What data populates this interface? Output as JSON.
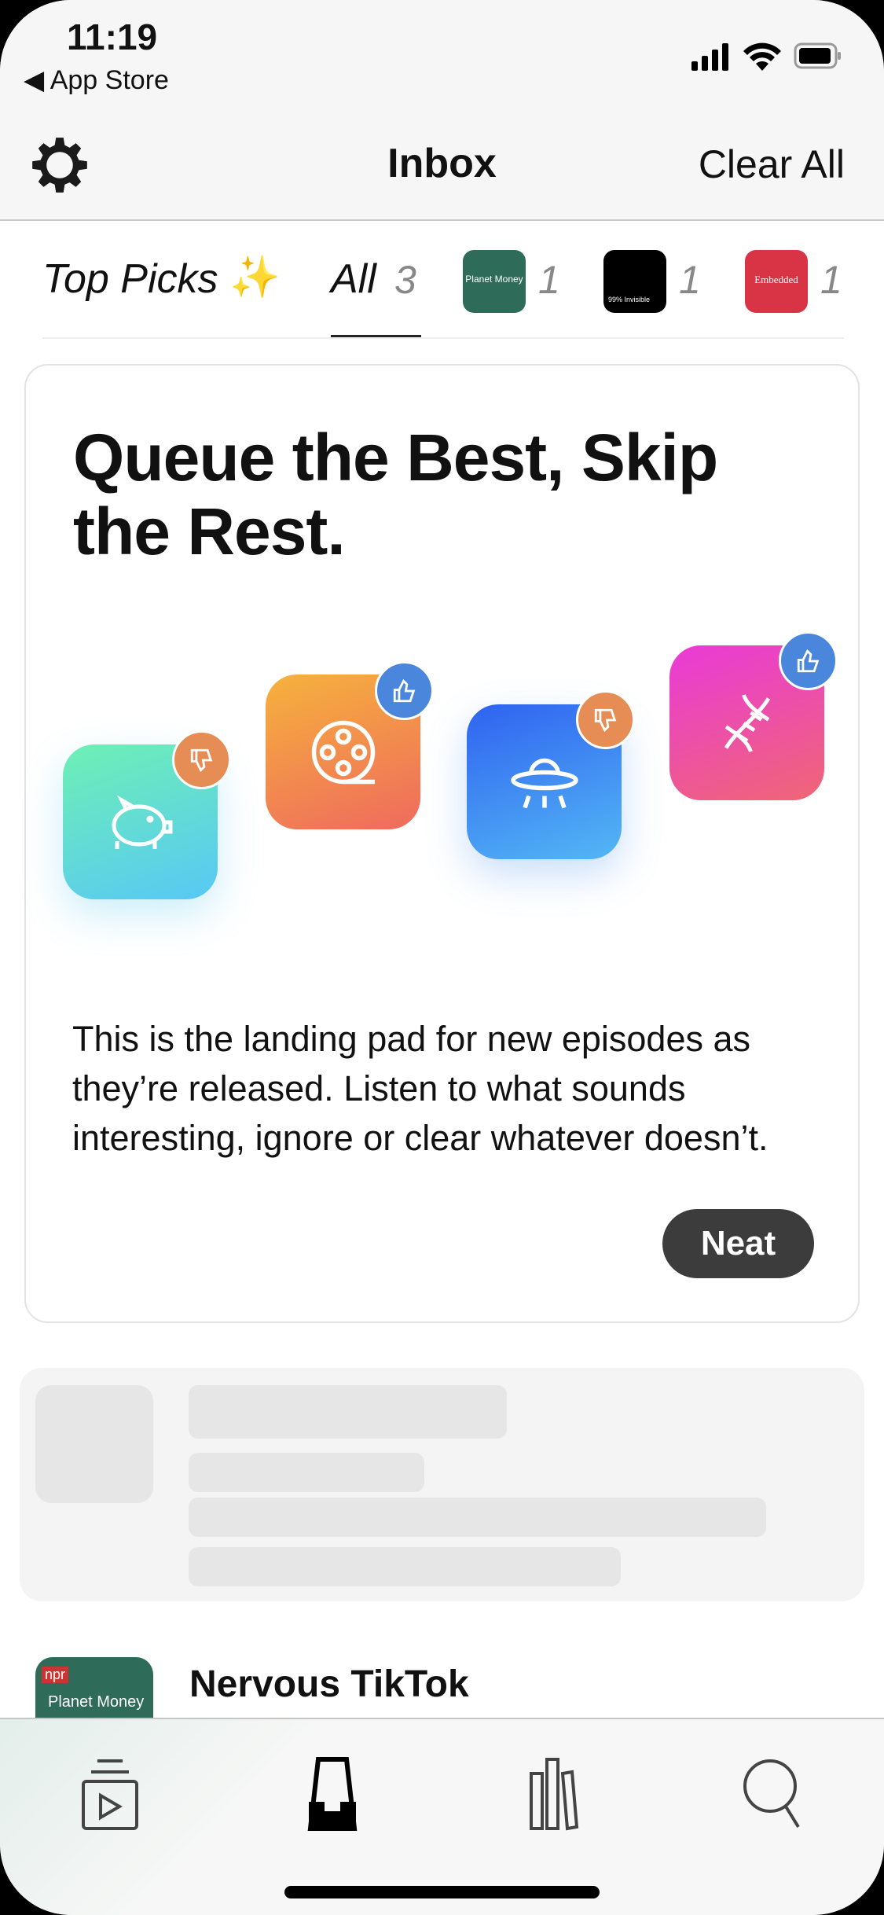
{
  "status": {
    "time": "11:19",
    "back": "App Store"
  },
  "nav": {
    "title": "Inbox",
    "clear_all": "Clear All",
    "settings_icon": "gear-icon"
  },
  "tabs": [
    {
      "label": "Top Picks",
      "emoji": "✨"
    },
    {
      "label": "All",
      "count": "3",
      "selected": true
    },
    {
      "podcast": "Planet Money",
      "count": "1",
      "color": "#2e6b58"
    },
    {
      "podcast": "99% Invisible",
      "count": "1",
      "color": "#000000"
    },
    {
      "podcast": "Embedded",
      "count": "1",
      "color": "#d83445"
    }
  ],
  "card": {
    "headline": "Queue the Best, Skip the Rest.",
    "icons": [
      {
        "icon": "piggy-bank-icon",
        "badge": "thumbs-down-icon"
      },
      {
        "icon": "film-reel-icon",
        "badge": "thumbs-up-icon"
      },
      {
        "icon": "ufo-icon",
        "badge": "thumbs-down-icon"
      },
      {
        "icon": "dna-icon",
        "badge": "thumbs-up-icon"
      }
    ],
    "body": "This is the landing pad for new episodes as they’re released. Listen to what sounds interesting, ignore or clear whatever doesn’t.",
    "button": "Neat"
  },
  "episode": {
    "podcast_art_text": "Planet Money",
    "art_badge": "npr",
    "title": "Nervous TikTok"
  },
  "tabbar": [
    {
      "icon": "up-next-icon"
    },
    {
      "icon": "inbox-icon",
      "selected": true
    },
    {
      "icon": "library-icon"
    },
    {
      "icon": "search-icon"
    }
  ]
}
